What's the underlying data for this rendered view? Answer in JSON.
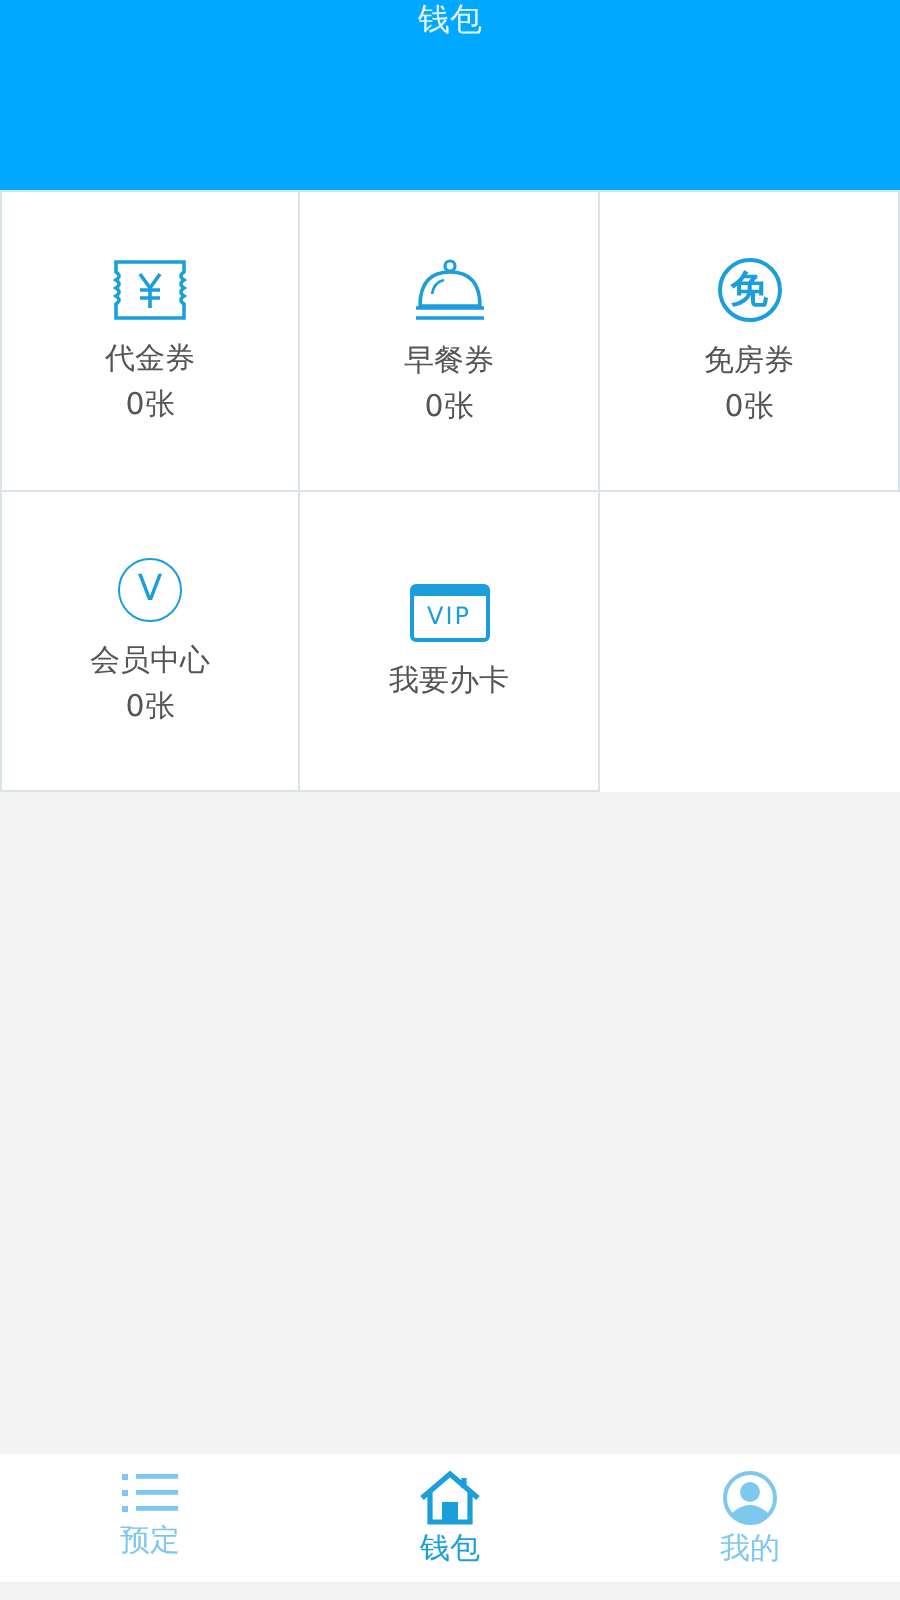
{
  "header": {
    "title": "钱包"
  },
  "tiles": [
    {
      "kind": "voucher",
      "label": "代金券",
      "count": "0张"
    },
    {
      "kind": "breakfast",
      "label": "早餐券",
      "count": "0张"
    },
    {
      "kind": "free",
      "label": "免房券",
      "count": "0张",
      "icon_text": "免"
    },
    {
      "kind": "member",
      "label": "会员中心",
      "count": "0张",
      "icon_text": "V"
    },
    {
      "kind": "card",
      "label": "我要办卡",
      "icon_text": "VIP"
    }
  ],
  "tabs": [
    {
      "kind": "list",
      "label": "预定",
      "selected": false
    },
    {
      "kind": "home",
      "label": "钱包",
      "selected": true
    },
    {
      "kind": "profile",
      "label": "我的",
      "selected": false
    }
  ]
}
